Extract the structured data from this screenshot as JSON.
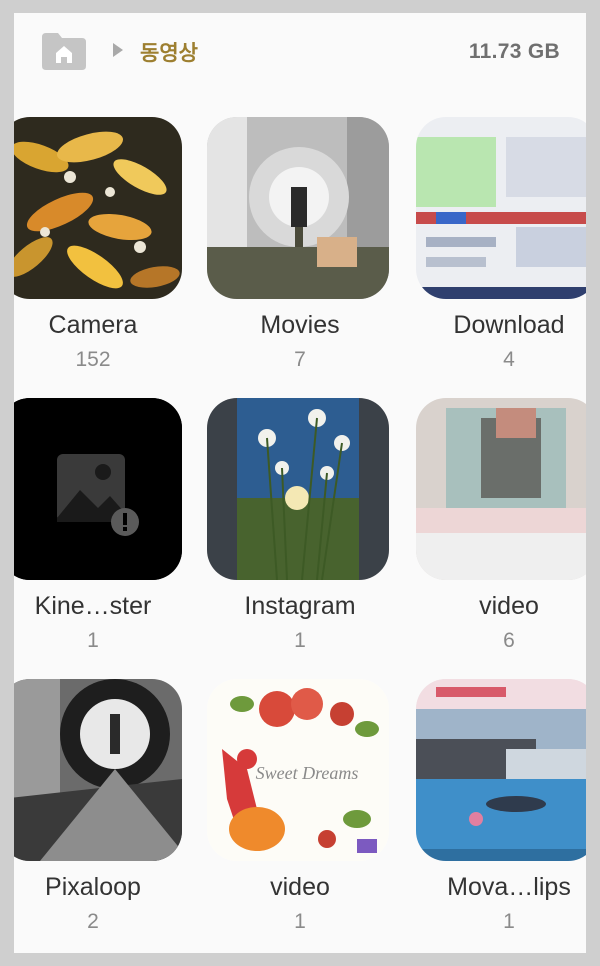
{
  "header": {
    "breadcrumb_label": "동영상",
    "storage_used": "11.73 GB"
  },
  "albums": [
    {
      "name": "Camera",
      "count": "152"
    },
    {
      "name": "Movies",
      "count": "7"
    },
    {
      "name": "Download",
      "count": "4"
    },
    {
      "name": "Kine…ster",
      "count": "1"
    },
    {
      "name": "Instagram",
      "count": "1"
    },
    {
      "name": "video",
      "count": "6"
    },
    {
      "name": "Pixaloop",
      "count": "2"
    },
    {
      "name": "video",
      "count": "1"
    },
    {
      "name": "Mova…lips",
      "count": "1"
    }
  ],
  "thumb_text": {
    "sweet_dreams": "Sweet Dreams"
  },
  "icons": {
    "home": "home-icon",
    "chevron": "chevron-right-icon",
    "broken_image": "broken-image-icon"
  },
  "colors": {
    "accent": "#9d7f30",
    "background": "#fafafa"
  }
}
